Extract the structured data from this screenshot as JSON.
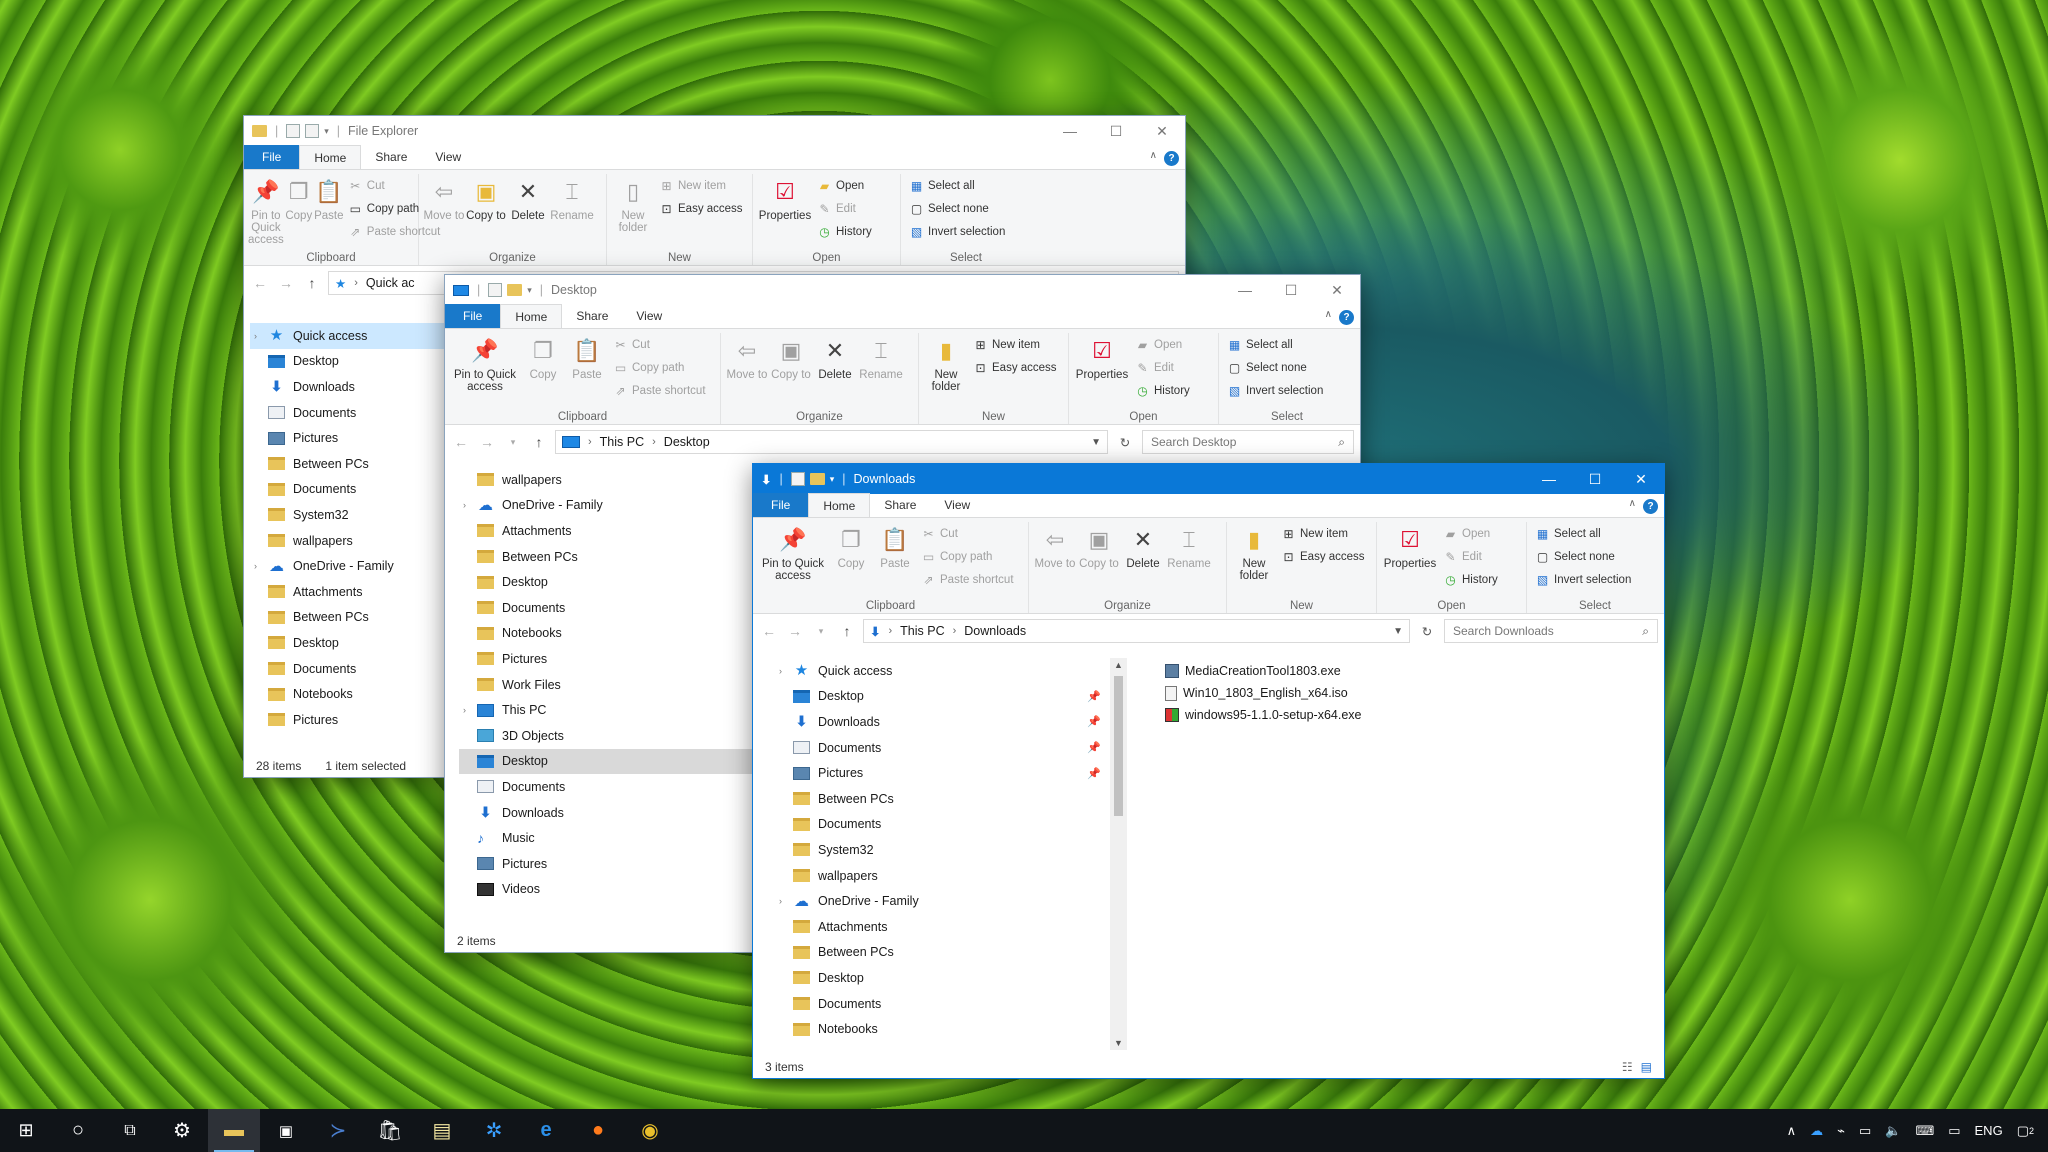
{
  "ribbon": {
    "tabs": {
      "file": "File",
      "home": "Home",
      "share": "Share",
      "view": "View"
    },
    "pin_quick": "Pin to Quick access",
    "copy": "Copy",
    "paste": "Paste",
    "cut": "Cut",
    "copy_path": "Copy path",
    "paste_shortcut": "Paste shortcut",
    "move_to": "Move to",
    "copy_to": "Copy to",
    "delete": "Delete",
    "rename": "Rename",
    "new_folder": "New folder",
    "new_item": "New item",
    "easy_access": "Easy access",
    "properties": "Properties",
    "open": "Open",
    "edit": "Edit",
    "history": "History",
    "select_all": "Select all",
    "select_none": "Select none",
    "invert_selection": "Invert selection",
    "groups": {
      "clipboard": "Clipboard",
      "organize": "Organize",
      "new": "New",
      "open": "Open",
      "select": "Select"
    }
  },
  "win1": {
    "title": "File Explorer",
    "address_partial": "Quick ac",
    "nav": [
      {
        "label": "Quick access",
        "icon": "star"
      },
      {
        "label": "Desktop",
        "icon": "blue"
      },
      {
        "label": "Downloads",
        "icon": "dl"
      },
      {
        "label": "Documents",
        "icon": "doc"
      },
      {
        "label": "Pictures",
        "icon": "pic"
      },
      {
        "label": "Between PCs",
        "icon": "folder"
      },
      {
        "label": "Documents",
        "icon": "folder"
      },
      {
        "label": "System32",
        "icon": "folder"
      },
      {
        "label": "wallpapers",
        "icon": "folder"
      },
      {
        "label": "OneDrive - Family",
        "icon": "cloud"
      },
      {
        "label": "Attachments",
        "icon": "folder"
      },
      {
        "label": "Between PCs",
        "icon": "folder"
      },
      {
        "label": "Desktop",
        "icon": "folder"
      },
      {
        "label": "Documents",
        "icon": "folder"
      },
      {
        "label": "Notebooks",
        "icon": "folder"
      },
      {
        "label": "Pictures",
        "icon": "folder"
      }
    ],
    "status_count": "28 items",
    "status_sel": "1 item selected"
  },
  "win2": {
    "title": "Desktop",
    "address": [
      "This PC",
      "Desktop"
    ],
    "search_placeholder": "Search Desktop",
    "nav": [
      {
        "label": "wallpapers",
        "icon": "folder"
      },
      {
        "label": "OneDrive - Family",
        "icon": "cloud"
      },
      {
        "label": "Attachments",
        "icon": "folder"
      },
      {
        "label": "Between PCs",
        "icon": "folder"
      },
      {
        "label": "Desktop",
        "icon": "folder"
      },
      {
        "label": "Documents",
        "icon": "folder"
      },
      {
        "label": "Notebooks",
        "icon": "folder"
      },
      {
        "label": "Pictures",
        "icon": "folder"
      },
      {
        "label": "Work Files",
        "icon": "folder"
      },
      {
        "label": "This PC",
        "icon": "pcn"
      },
      {
        "label": "3D Objects",
        "icon": "obj"
      },
      {
        "label": "Desktop",
        "icon": "blue"
      },
      {
        "label": "Documents",
        "icon": "doc"
      },
      {
        "label": "Downloads",
        "icon": "dl"
      },
      {
        "label": "Music",
        "icon": "music"
      },
      {
        "label": "Pictures",
        "icon": "pic"
      },
      {
        "label": "Videos",
        "icon": "vid"
      }
    ],
    "status_count": "2 items"
  },
  "win3": {
    "title": "Downloads",
    "address": [
      "This PC",
      "Downloads"
    ],
    "search_placeholder": "Search Downloads",
    "nav": [
      {
        "label": "Quick access",
        "icon": "star"
      },
      {
        "label": "Desktop",
        "icon": "blue"
      },
      {
        "label": "Downloads",
        "icon": "dl"
      },
      {
        "label": "Documents",
        "icon": "doc"
      },
      {
        "label": "Pictures",
        "icon": "pic"
      },
      {
        "label": "Between PCs",
        "icon": "folder"
      },
      {
        "label": "Documents",
        "icon": "folder"
      },
      {
        "label": "System32",
        "icon": "folder"
      },
      {
        "label": "wallpapers",
        "icon": "folder"
      },
      {
        "label": "OneDrive - Family",
        "icon": "cloud"
      },
      {
        "label": "Attachments",
        "icon": "folder"
      },
      {
        "label": "Between PCs",
        "icon": "folder"
      },
      {
        "label": "Desktop",
        "icon": "folder"
      },
      {
        "label": "Documents",
        "icon": "folder"
      },
      {
        "label": "Notebooks",
        "icon": "folder"
      }
    ],
    "files": [
      "MediaCreationTool1803.exe",
      "Win10_1803_English_x64.iso",
      "windows95-1.1.0-setup-x64.exe"
    ],
    "status_count": "3 items"
  },
  "taskbar": {
    "lang": "ENG",
    "notif_count": "2"
  }
}
